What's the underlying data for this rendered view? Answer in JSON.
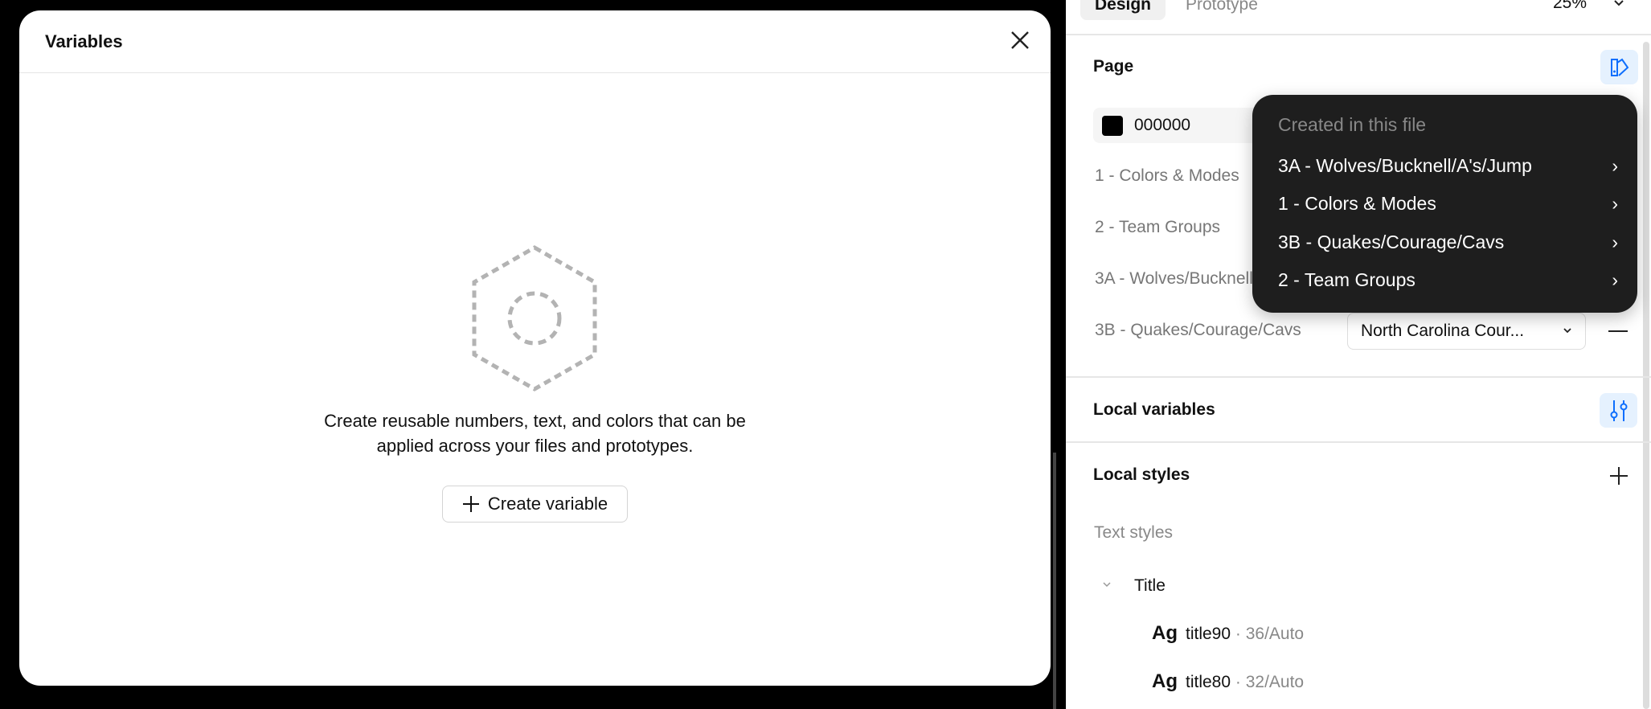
{
  "modal": {
    "title": "Variables",
    "empty_line1": "Create reusable numbers, text, and colors that can be",
    "empty_line2": "applied across your files and prototypes.",
    "create_button": "Create variable"
  },
  "panel": {
    "tabs": [
      {
        "label": "Design",
        "active": true
      },
      {
        "label": "Prototype",
        "active": false
      }
    ],
    "zoom": "25%",
    "page": {
      "title": "Page",
      "color_value": "000000",
      "color": "#000000"
    },
    "modes": [
      {
        "label": "1 - Colors & Modes"
      },
      {
        "label": "2 - Team Groups"
      },
      {
        "label": "3A - Wolves/Bucknell/A's/Jump"
      },
      {
        "label": "3B - Quakes/Courage/Cavs",
        "value": "North Carolina Cour..."
      }
    ],
    "local_variables": "Local variables",
    "local_styles": "Local styles",
    "text_styles": "Text styles",
    "group": "Title",
    "styles": [
      {
        "preview": "Ag",
        "name": "title90",
        "meta": " · 36/Auto"
      },
      {
        "preview": "Ag",
        "name": "title80",
        "meta": " · 32/Auto"
      }
    ]
  },
  "menu": {
    "header": "Created in this file",
    "items": [
      "3A - Wolves/Bucknell/A's/Jump",
      "1 - Colors & Modes",
      "3B - Quakes/Courage/Cavs",
      "2 - Team Groups"
    ]
  },
  "colors": {
    "accent": "#0d6efd",
    "menu_bg": "#1e1e1e"
  }
}
